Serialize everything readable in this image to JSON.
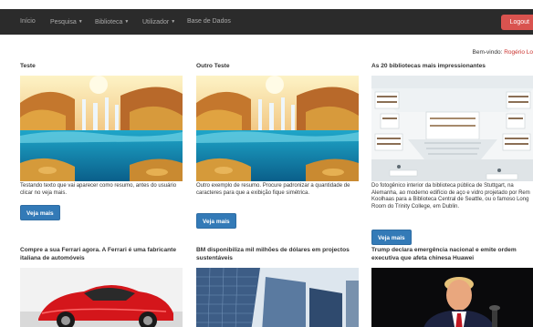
{
  "nav": {
    "items": [
      {
        "label": "Início",
        "dropdown": false
      },
      {
        "label": "Pesquisa",
        "dropdown": true
      },
      {
        "label": "Biblioteca",
        "dropdown": true
      },
      {
        "label": "Utilizador",
        "dropdown": true
      },
      {
        "label": "Base de Dados",
        "dropdown": false
      }
    ],
    "logout_label": "Logout",
    "colors": {
      "bar": "#2b2b2b",
      "logout": "#d9534f",
      "link": "#a9a9a9"
    }
  },
  "welcome": {
    "prefix": "Bem-vindo:",
    "user": "Rogério Lo"
  },
  "button_label": "Veja mais",
  "cards": [
    {
      "title": "Teste",
      "image": "waterfall-lake-image",
      "text": "Testando texto que vai aparecer como resumo, antes do usuário clicar no veja mais."
    },
    {
      "title": "Outro Teste",
      "image": "waterfall-lake-image",
      "text": "Outro exemplo de resumo. Procure padronizar a quantidade de caracteres para que a exibição fique simétrica."
    },
    {
      "title": "As 20 bibliotecas mais impressionantes",
      "image": "library-interior-image",
      "text": "Do fotogênico interior da biblioteca pública de Stuttgart, na Alemanha, ao moderno edifício de aço e vidro projetado por Rem Koolhaas para a Biblioteca Central de Seattle, ou o famoso Long Room do Trinity College, em Dublin."
    },
    {
      "title": "Compre a sua Ferrari agora. A Ferrari é uma fabricante italiana de automóveis",
      "image": "red-sports-car-image"
    },
    {
      "title": "BM disponibiliza mil milhões de dólares em projectos sustentáveis",
      "image": "office-buildings-image"
    },
    {
      "title": "Trump declara emergência nacional e emite ordem executiva que afeta chinesa Huawei",
      "image": "speaker-portrait-image"
    }
  ]
}
